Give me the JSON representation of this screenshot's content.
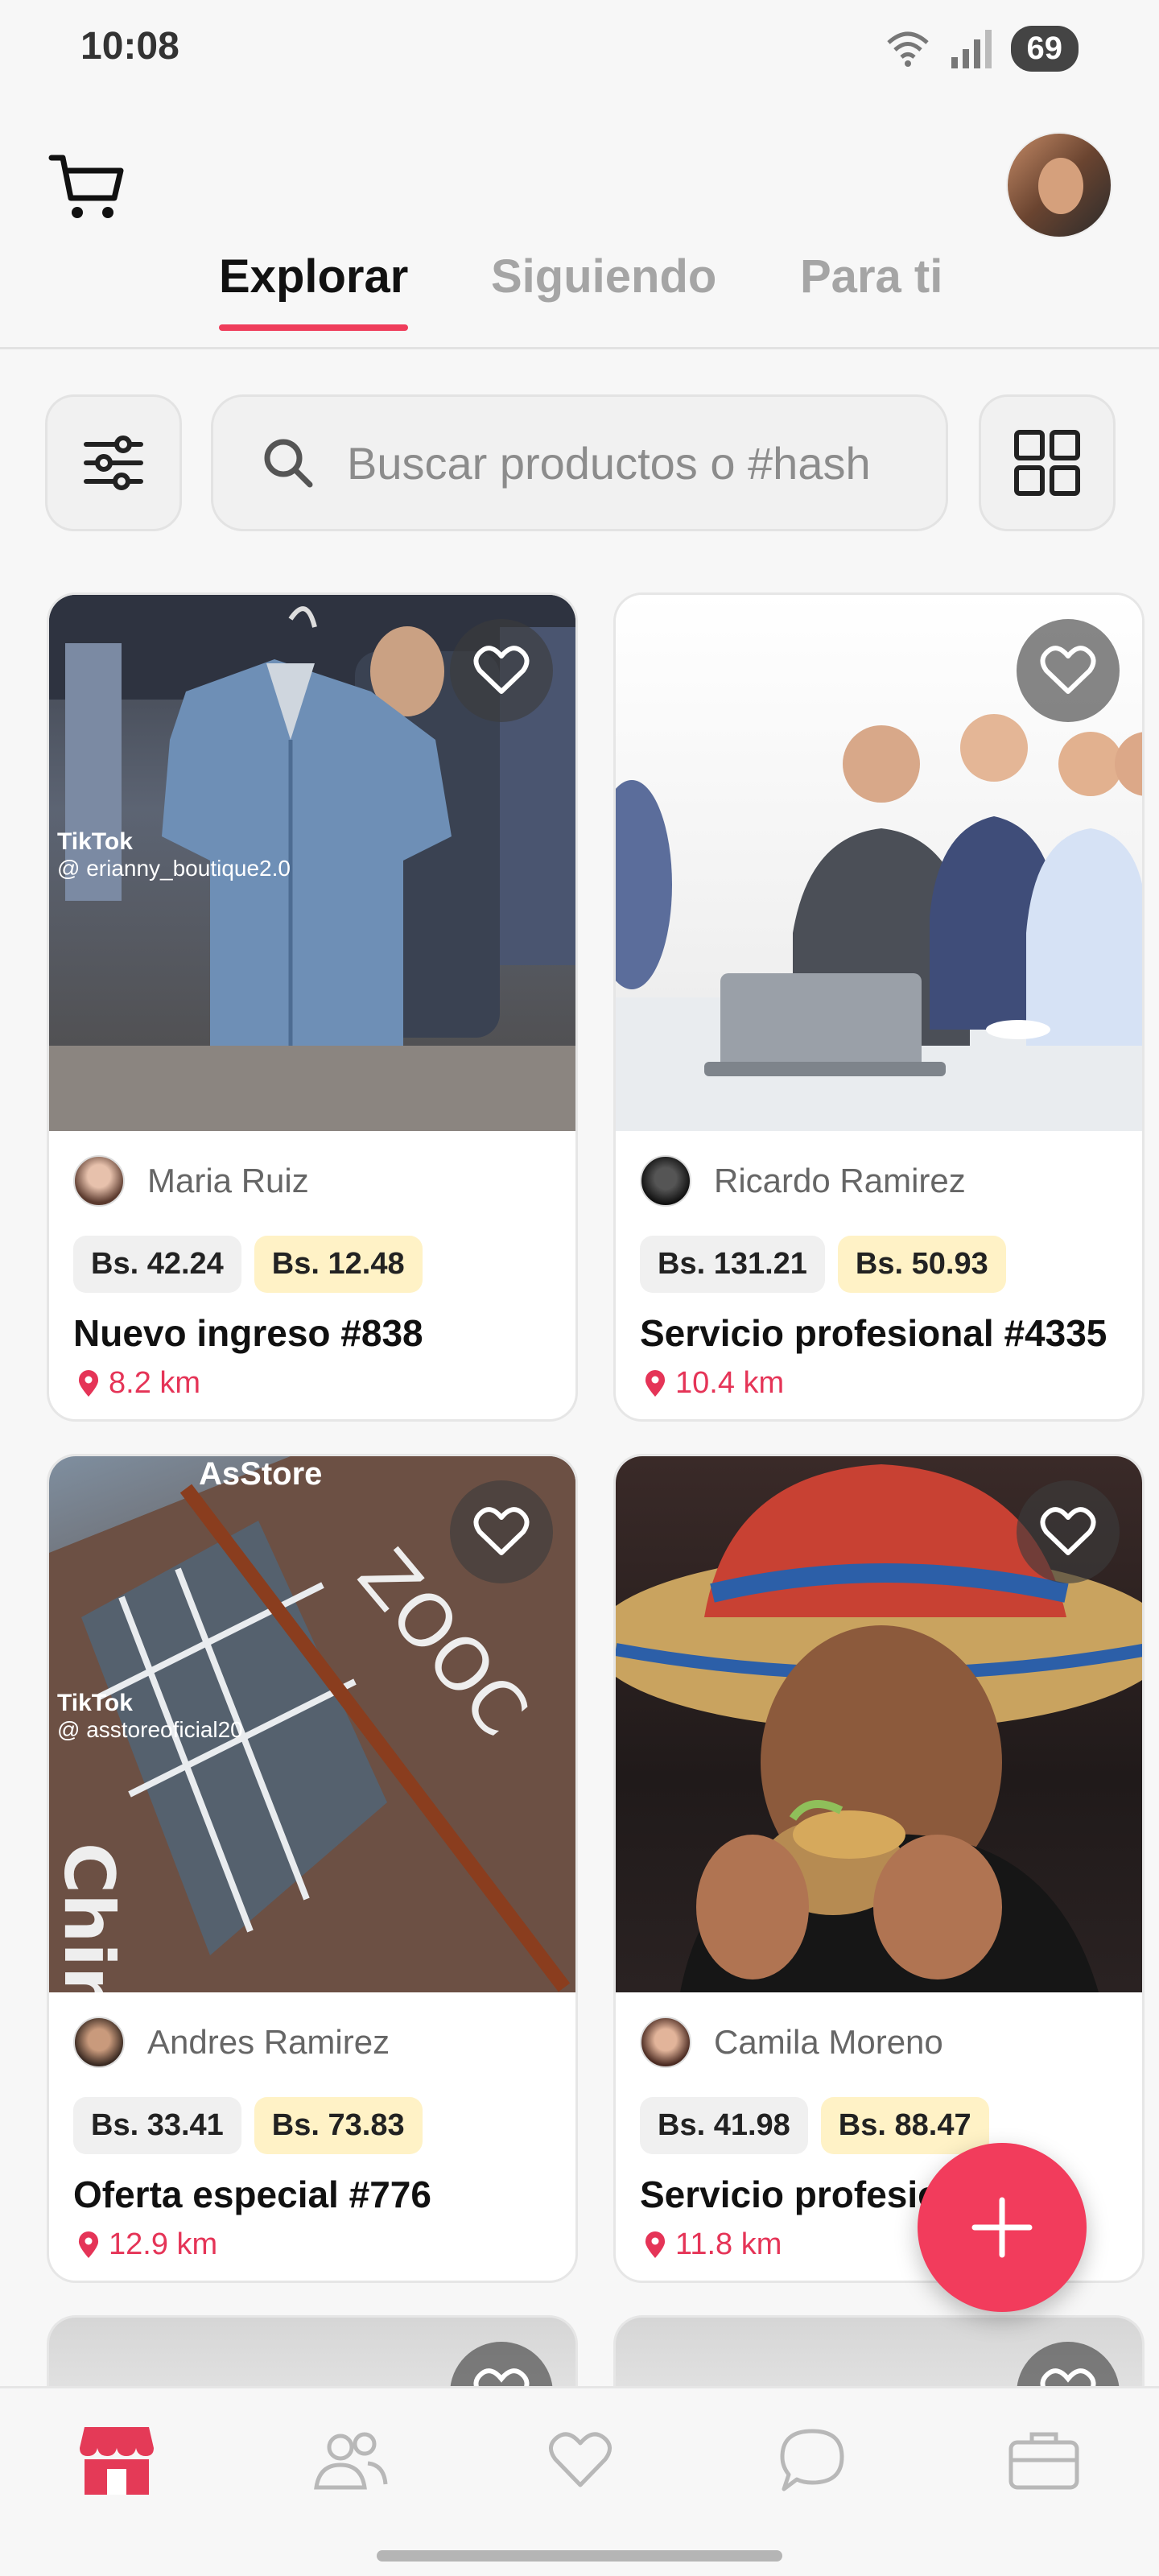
{
  "status_bar": {
    "time": "10:08",
    "battery": "69"
  },
  "header": {
    "tabs": [
      {
        "label": "Explorar",
        "active": true
      },
      {
        "label": "Siguiendo",
        "active": false
      },
      {
        "label": "Para ti",
        "active": false
      }
    ]
  },
  "search": {
    "placeholder": "Buscar productos o #hashtags"
  },
  "cards": [
    {
      "seller": "Maria Ruiz",
      "price": "Bs. 42.24",
      "offer_price": "Bs. 12.48",
      "title": "Nuevo ingreso #838",
      "distance": "8.2 km",
      "watermark_brand": "TikTok",
      "watermark_handle": "@ erianny_boutique2.0"
    },
    {
      "seller": "Ricardo Ramirez",
      "price": "Bs. 131.21",
      "offer_price": "Bs. 50.93",
      "title": "Servicio profesional #4335",
      "distance": "10.4 km"
    },
    {
      "seller": "Andres Ramirez",
      "price": "Bs. 33.41",
      "offer_price": "Bs. 73.83",
      "title": "Oferta especial #776",
      "distance": "12.9 km",
      "image_caption": "AsStore",
      "watermark_brand": "TikTok",
      "watermark_handle": "@ asstoreoficial20"
    },
    {
      "seller": "Camila Moreno",
      "price": "Bs. 41.98",
      "offer_price": "Bs. 88.47",
      "title": "Servicio profesion",
      "distance": "11.8 km"
    }
  ],
  "colors": {
    "accent": "#ef3d5b",
    "offer_bg": "#fff2c6",
    "distance": "#e53457"
  },
  "icons": {
    "bottom_nav": [
      "store-icon",
      "users-icon",
      "heart-icon",
      "chat-icon",
      "briefcase-icon"
    ],
    "header": [
      "cart-icon",
      "profile-avatar"
    ],
    "search_row": [
      "filter-icon",
      "search-icon",
      "grid-icon"
    ]
  }
}
